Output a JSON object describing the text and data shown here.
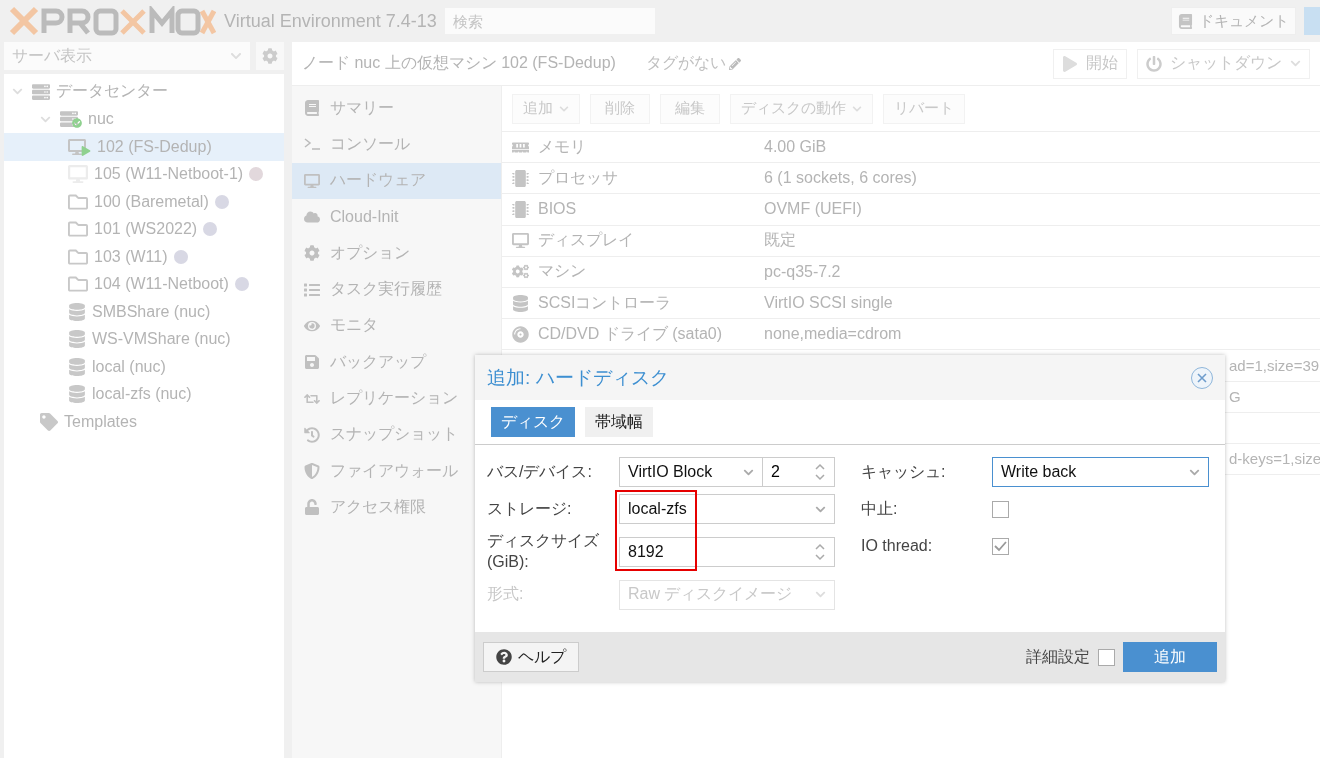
{
  "header": {
    "version": "Virtual Environment 7.4-13",
    "search": {
      "placeholder": "検索"
    },
    "docs_button": "ドキュメント"
  },
  "sidebar": {
    "view_select": "サーバ表示",
    "tree": [
      {
        "label": "データセンター",
        "kind": "datacenter",
        "expanded": true,
        "children": [
          {
            "label": "nuc",
            "kind": "node",
            "expanded": true,
            "children": [
              {
                "label": "102 (FS-Dedup)",
                "kind": "vm-running",
                "selected": true
              },
              {
                "label": "105 (W11-Netboot-1)",
                "kind": "vm",
                "selected": false,
                "color": "#e2d8dc"
              },
              {
                "label": "100 (Baremetal)",
                "kind": "template",
                "selected": false,
                "color": "#d8d8e4"
              },
              {
                "label": "101 (WS2022)",
                "kind": "template",
                "selected": false,
                "color": "#d8d8e4"
              },
              {
                "label": "103 (W11)",
                "kind": "template",
                "selected": false,
                "color": "#d8d8e4"
              },
              {
                "label": "104 (W11-Netboot)",
                "kind": "template",
                "selected": false,
                "color": "#d8d8e4"
              },
              {
                "label": "SMBShare (nuc)",
                "kind": "storage",
                "selected": false
              },
              {
                "label": "WS-VMShare (nuc)",
                "kind": "storage",
                "selected": false
              },
              {
                "label": "local (nuc)",
                "kind": "storage",
                "selected": false
              },
              {
                "label": "local-zfs (nuc)",
                "kind": "storage",
                "selected": false
              }
            ]
          },
          {
            "label": "Templates",
            "kind": "tag",
            "selected": false
          }
        ]
      }
    ]
  },
  "content": {
    "title": "ノード nuc 上の仮想マシン 102 (FS-Dedup)",
    "tags": "タグがない",
    "start_button": "開始",
    "shutdown_button": "シャットダウン",
    "nav": [
      {
        "label": "サマリー",
        "selected": false
      },
      {
        "label": "コンソール",
        "selected": false
      },
      {
        "label": "ハードウェア",
        "selected": true
      },
      {
        "label": "Cloud-Init",
        "selected": false
      },
      {
        "label": "オプション",
        "selected": false
      },
      {
        "label": "タスク実行履歴",
        "selected": false
      },
      {
        "label": "モニタ",
        "selected": false
      },
      {
        "label": "バックアップ",
        "selected": false
      },
      {
        "label": "レプリケーション",
        "selected": false
      },
      {
        "label": "スナップショット",
        "selected": false
      },
      {
        "label": "ファイアウォール",
        "selected": false
      },
      {
        "label": "アクセス権限",
        "selected": false
      }
    ],
    "toolbar": [
      {
        "label": "追加",
        "menu": true
      },
      {
        "label": "削除",
        "menu": false
      },
      {
        "label": "編集",
        "menu": false
      },
      {
        "label": "ディスクの動作",
        "menu": true
      },
      {
        "label": "リバート",
        "menu": false
      }
    ],
    "hardware": [
      {
        "kind": "row",
        "label": "メモリ",
        "value": "4.00 GiB"
      },
      {
        "kind": "row",
        "label": "プロセッサ",
        "value": "6 (1 sockets, 6 cores)"
      },
      {
        "kind": "row",
        "label": "BIOS",
        "value": "OVMF (UEFI)"
      },
      {
        "kind": "row",
        "label": "ディスプレイ",
        "value": "既定"
      },
      {
        "kind": "row",
        "label": "マシン",
        "value": "pc-q35-7.2"
      },
      {
        "kind": "row",
        "label": "SCSIコントローラ",
        "value": "VirtIO SCSI single"
      },
      {
        "kind": "row",
        "label": "CD/DVD ドライブ (sata0)",
        "value": "none,media=cdrom"
      },
      {
        "kind": "fragment",
        "value": "ad=1,size=39"
      },
      {
        "kind": "fragment",
        "value": "G"
      },
      {
        "kind": "blank"
      },
      {
        "kind": "fragment",
        "value": "d-keys=1,size"
      }
    ]
  },
  "dialog": {
    "title": "追加: ハードディスク",
    "tabs": [
      {
        "label": "ディスク",
        "selected": true
      },
      {
        "label": "帯域幅",
        "selected": false
      }
    ],
    "left": [
      {
        "label": "バス/デバイス:",
        "kind": "bus",
        "value": "VirtIO Block",
        "number": "2",
        "disabled": false,
        "highlighted": false
      },
      {
        "label": "ストレージ:",
        "kind": "select",
        "value": "local-zfs",
        "disabled": false,
        "highlighted": true
      },
      {
        "label": "ディスクサイズ (GiB):",
        "kind": "spinner",
        "value": "8192",
        "disabled": false,
        "highlighted": true
      },
      {
        "label": "形式:",
        "kind": "select",
        "value": "Raw ディスクイメージ",
        "disabled": true,
        "highlighted": false
      }
    ],
    "right": [
      {
        "label": "キャッシュ:",
        "kind": "select",
        "value": "Write back",
        "focused": true
      },
      {
        "label": "中止:",
        "kind": "checkbox",
        "checked": false
      },
      {
        "label": "IO thread:",
        "kind": "checkbox",
        "checked": true
      }
    ],
    "help_button": "ヘルプ",
    "advanced": {
      "label": "詳細設定",
      "checked": false
    },
    "submit_button": "追加"
  }
}
